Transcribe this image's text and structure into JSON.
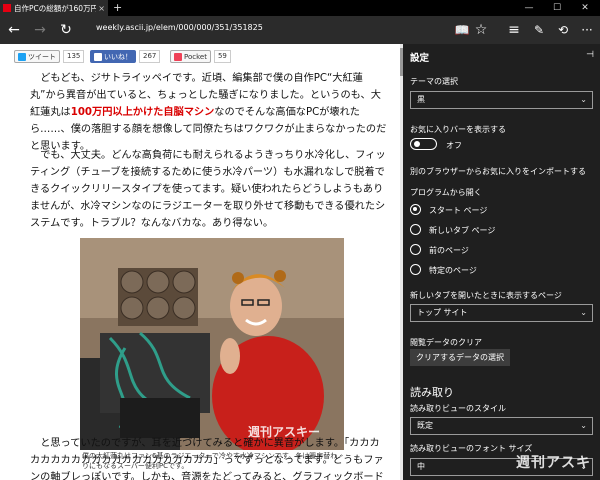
{
  "tab": {
    "title": "自作PCの総額が160万円",
    "close": "×",
    "new": "+"
  },
  "window": {
    "minimize": "—",
    "maximize": "☐",
    "close": "✕"
  },
  "nav": {
    "back": "←",
    "forward": "→",
    "refresh": "↻",
    "url": "weekly.ascii.jp/elem/000/000/351/351825",
    "reading_view": "📖",
    "favorite": "☆",
    "hub": "≡",
    "note": "✎",
    "share": "⟲",
    "more": "···"
  },
  "share": {
    "tweet": "ツイート",
    "tweet_count": "135",
    "like": "いいね！",
    "like_count": "267",
    "pocket": "Pocket",
    "pocket_count": "59"
  },
  "article": {
    "p1a": "どもども、ジサトライッペイです。近頃、編集部で僕の自作PC“大紅蓮丸”から異音が出ていると、ちょっとした騒ぎになりました。というのも、大紅蓮丸は",
    "p1hl": "100万円以上かけた自脳マシン",
    "p1b": "なのでそんな高価なPCが壊れたら……、僕の落胆する顔を想像して同僚たちはワクワクが止まらなかったのだと思います。",
    "p2": "でも、大丈夫。どんな高負荷にも耐えられるようきっちり水冷化し、フィッティング（チューブを接続するために使う水冷パーツ）も水漏れなしで脱着できるクイックリリースタイプを使ってます。疑い使われたらどうしようもありませんが、水冷マシンなのにラジエーターを取り外せて移動もできる優れたシステムです。トラブル？なんなバカな。あり得ない。",
    "caption": "僕の大紅蓮丸はファン6基のラジエーターで冷やす水冷マシンです。冬は暖房替わりにもなるスーパー便利PCです。",
    "photo_watermark": "週刊アスキー",
    "p3": "と思っていたのですが、耳を近づけてみると確かに異音がします。「カカカカカカカカカカカカカカカカカカカカカ」ってずっとなってます。どうもファンの軸ブレっぽいです。しかも、音源をたどってみると、グラフィックボードくさい。外してみましょう。"
  },
  "settings": {
    "title": "設定",
    "pin": "⊣",
    "theme_label": "テーマの選択",
    "theme_value": "黒",
    "favbar_label": "お気に入りバーを表示する",
    "favbar_state": "オフ",
    "import_link": "別のブラウザーからお気に入りをインポートする",
    "open_with_label": "プログラムから開く",
    "open_with_options": [
      "スタート ページ",
      "新しいタブ ページ",
      "前のページ",
      "特定のページ"
    ],
    "newtab_label": "新しいタブを開いたときに表示するページ",
    "newtab_value": "トップ サイト",
    "clear_label": "閲覧データのクリア",
    "clear_button": "クリアするデータの選択",
    "reading_head": "読み取り",
    "reading_style_label": "読み取りビューのスタイル",
    "reading_style_value": "既定",
    "reading_font_label": "読み取りビューのフォント サイズ",
    "reading_font_value": "中",
    "watermark": "週刊アスキー"
  }
}
